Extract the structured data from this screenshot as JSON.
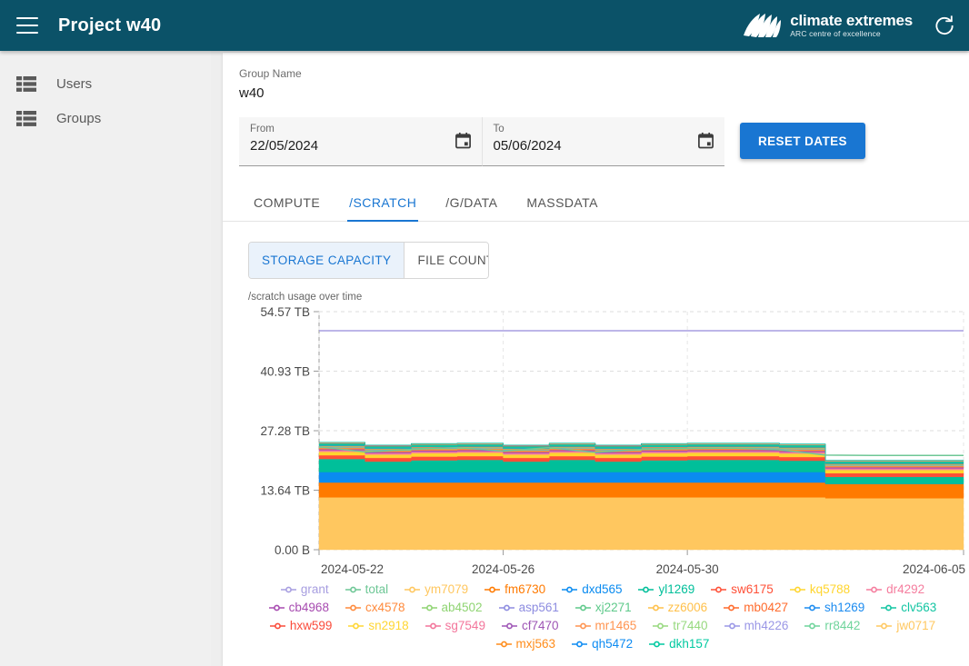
{
  "appbar": {
    "menu_icon": "hamburger-icon",
    "title": "Project w40",
    "logo_main": "climate extremes",
    "logo_sub": "ARC centre of excellence",
    "refresh_icon": "refresh-icon",
    "bg_color": "#0b5268"
  },
  "sidebar": {
    "items": [
      {
        "label": "Users",
        "icon": "list-icon"
      },
      {
        "label": "Groups",
        "icon": "list-icon"
      }
    ]
  },
  "form": {
    "group_name_label": "Group Name",
    "group_name_value": "w40",
    "from_label": "From",
    "from_value": "22/05/2024",
    "to_label": "To",
    "to_value": "05/06/2024",
    "calendar_icon": "calendar-icon",
    "reset_button": "RESET DATES"
  },
  "tabs": {
    "items": [
      "COMPUTE",
      "/SCRATCH",
      "/G/DATA",
      "MASSDATA"
    ],
    "active": "/SCRATCH",
    "accent": "#1976d2"
  },
  "subtabs": {
    "items": [
      "STORAGE CAPACITY",
      "FILE COUNTS"
    ],
    "active": "STORAGE CAPACITY"
  },
  "chart_data": {
    "type": "area",
    "title": "/scratch usage over time",
    "xlabel": "",
    "ylabel": "",
    "grid": true,
    "legend_position": "bottom",
    "ylim": [
      0,
      54.57
    ],
    "y_unit": "TB",
    "yticks": [
      0,
      13.64,
      27.28,
      40.93,
      54.57
    ],
    "ytick_labels": [
      "0.00 B",
      "13.64 TB",
      "27.28 TB",
      "40.93 TB",
      "54.57 TB"
    ],
    "x": [
      "2024-05-22",
      "2024-05-23",
      "2024-05-24",
      "2024-05-25",
      "2024-05-26",
      "2024-05-27",
      "2024-05-28",
      "2024-05-29",
      "2024-05-30",
      "2024-05-31",
      "2024-06-01",
      "2024-06-02",
      "2024-06-03",
      "2024-06-04",
      "2024-06-05"
    ],
    "xtick_labels": [
      "2024-05-22",
      "2024-05-26",
      "2024-05-30",
      "2024-06-05"
    ],
    "xtick_positions": [
      0,
      4,
      8,
      14
    ],
    "lines": [
      {
        "name": "grant",
        "color": "#a79ee0",
        "type": "line",
        "values": [
          50.2,
          50.2,
          50.2,
          50.2,
          50.2,
          50.2,
          50.2,
          50.2,
          50.2,
          50.2,
          50.2,
          50.2,
          50.2,
          50.2,
          50.2
        ]
      },
      {
        "name": "total",
        "color": "#6ec796",
        "type": "line",
        "values": [
          23.6,
          22.4,
          23.0,
          23.4,
          22.6,
          23.4,
          22.3,
          23.0,
          23.2,
          23.3,
          22.9,
          21.7,
          21.6,
          21.6,
          21.6
        ]
      }
    ],
    "series": [
      {
        "name": "ym7079",
        "color": "#ffc75f",
        "values": [
          12.0,
          12.0,
          12.0,
          12.0,
          12.0,
          12.0,
          12.0,
          12.0,
          12.0,
          12.0,
          12.0,
          11.8,
          11.8,
          11.8,
          11.8
        ]
      },
      {
        "name": "fm6730",
        "color": "#ff7a00",
        "values": [
          3.4,
          3.4,
          3.4,
          3.4,
          3.4,
          3.4,
          3.4,
          3.4,
          3.4,
          3.4,
          3.4,
          3.3,
          3.3,
          3.3,
          3.3
        ]
      },
      {
        "name": "dxd565",
        "color": "#0a8bf0",
        "values": [
          2.4,
          2.4,
          2.4,
          2.4,
          2.4,
          2.4,
          2.4,
          2.4,
          2.4,
          2.4,
          2.4,
          0.0,
          0.0,
          0.0,
          0.0
        ]
      },
      {
        "name": "yl1269",
        "color": "#00bf9a",
        "values": [
          3.0,
          2.4,
          2.7,
          2.8,
          2.4,
          2.8,
          2.4,
          2.7,
          2.8,
          2.8,
          2.6,
          1.6,
          1.6,
          1.6,
          1.6
        ]
      },
      {
        "name": "sw6175",
        "color": "#ff4f36",
        "values": [
          0.85,
          0.85,
          0.85,
          0.85,
          0.85,
          0.85,
          0.85,
          0.85,
          0.85,
          0.85,
          0.85,
          0.85,
          0.85,
          0.85,
          0.85
        ]
      },
      {
        "name": "kq5788",
        "color": "#ffd52e",
        "values": [
          0.8,
          0.75,
          0.8,
          0.8,
          0.75,
          0.8,
          0.75,
          0.8,
          0.8,
          0.8,
          0.8,
          0.75,
          0.75,
          0.75,
          0.75
        ]
      },
      {
        "name": "dr4292",
        "color": "#f57d9e",
        "values": [
          0.35,
          0.35,
          0.35,
          0.35,
          0.35,
          0.35,
          0.35,
          0.35,
          0.35,
          0.35,
          0.35,
          0.35,
          0.35,
          0.35,
          0.35
        ]
      },
      {
        "name": "cb4968",
        "color": "#a74bb0",
        "values": [
          0.25,
          0.25,
          0.25,
          0.25,
          0.25,
          0.25,
          0.25,
          0.25,
          0.25,
          0.25,
          0.25,
          0.25,
          0.25,
          0.25,
          0.25
        ]
      },
      {
        "name": "cx4578",
        "color": "#ff8a3c",
        "values": [
          0.3,
          0.3,
          0.3,
          0.3,
          0.3,
          0.3,
          0.3,
          0.3,
          0.3,
          0.3,
          0.3,
          0.3,
          0.3,
          0.3,
          0.3
        ]
      },
      {
        "name": "ab4502",
        "color": "#8fd472",
        "values": [
          0.12,
          0.12,
          0.12,
          0.12,
          0.12,
          0.12,
          0.12,
          0.12,
          0.12,
          0.12,
          0.12,
          0.12,
          0.12,
          0.12,
          0.12
        ]
      },
      {
        "name": "asp561",
        "color": "#8d8ce0",
        "values": [
          0.1,
          0.1,
          0.1,
          0.1,
          0.1,
          0.1,
          0.1,
          0.1,
          0.1,
          0.1,
          0.1,
          0.1,
          0.1,
          0.1,
          0.1
        ]
      },
      {
        "name": "xj2271",
        "color": "#5ec98a",
        "values": [
          0.1,
          0.1,
          0.1,
          0.1,
          0.1,
          0.1,
          0.1,
          0.1,
          0.1,
          0.1,
          0.1,
          0.1,
          0.1,
          0.1,
          0.1
        ]
      },
      {
        "name": "zz6006",
        "color": "#ffc04a",
        "values": [
          0.08,
          0.08,
          0.08,
          0.08,
          0.08,
          0.08,
          0.08,
          0.08,
          0.08,
          0.08,
          0.08,
          0.08,
          0.08,
          0.08,
          0.08
        ]
      },
      {
        "name": "mb0427",
        "color": "#ff6a2b",
        "values": [
          0.08,
          0.08,
          0.08,
          0.08,
          0.08,
          0.08,
          0.08,
          0.08,
          0.08,
          0.08,
          0.08,
          0.08,
          0.08,
          0.08,
          0.08
        ]
      },
      {
        "name": "sh1269",
        "color": "#1b8bf0",
        "values": [
          0.06,
          0.06,
          0.06,
          0.06,
          0.06,
          0.06,
          0.06,
          0.06,
          0.06,
          0.06,
          0.06,
          0.06,
          0.06,
          0.06,
          0.06
        ]
      },
      {
        "name": "clv563",
        "color": "#12c5a2",
        "values": [
          0.5,
          0.5,
          0.5,
          0.5,
          0.5,
          0.5,
          0.5,
          0.5,
          0.5,
          0.5,
          0.5,
          0.5,
          0.5,
          0.5,
          0.5
        ]
      },
      {
        "name": "hxw599",
        "color": "#fa4b3a",
        "values": [
          0.04,
          0.04,
          0.04,
          0.04,
          0.04,
          0.04,
          0.04,
          0.04,
          0.04,
          0.04,
          0.04,
          0.04,
          0.04,
          0.04,
          0.04
        ]
      },
      {
        "name": "sn2918",
        "color": "#ffd633",
        "values": [
          0.04,
          0.04,
          0.04,
          0.04,
          0.04,
          0.04,
          0.04,
          0.04,
          0.04,
          0.04,
          0.04,
          0.04,
          0.04,
          0.04,
          0.04
        ]
      },
      {
        "name": "sg7549",
        "color": "#f3759b",
        "values": [
          0.03,
          0.03,
          0.03,
          0.03,
          0.03,
          0.03,
          0.03,
          0.03,
          0.03,
          0.03,
          0.03,
          0.03,
          0.03,
          0.03,
          0.03
        ]
      },
      {
        "name": "cf7470",
        "color": "#9e55b5",
        "values": [
          0.03,
          0.03,
          0.03,
          0.03,
          0.03,
          0.03,
          0.03,
          0.03,
          0.03,
          0.03,
          0.03,
          0.03,
          0.03,
          0.03,
          0.03
        ]
      },
      {
        "name": "mr1465",
        "color": "#ff9450",
        "values": [
          0.02,
          0.02,
          0.02,
          0.02,
          0.02,
          0.02,
          0.02,
          0.02,
          0.02,
          0.02,
          0.02,
          0.02,
          0.02,
          0.02,
          0.02
        ]
      },
      {
        "name": "tr7440",
        "color": "#97d97f",
        "values": [
          0.02,
          0.02,
          0.02,
          0.02,
          0.02,
          0.02,
          0.02,
          0.02,
          0.02,
          0.02,
          0.02,
          0.02,
          0.02,
          0.02,
          0.02
        ]
      },
      {
        "name": "mh4226",
        "color": "#9a97e6",
        "values": [
          0.02,
          0.02,
          0.02,
          0.02,
          0.02,
          0.02,
          0.02,
          0.02,
          0.02,
          0.02,
          0.02,
          0.02,
          0.02,
          0.02,
          0.02
        ]
      },
      {
        "name": "rr8442",
        "color": "#6fd49b",
        "values": [
          0.01,
          0.01,
          0.01,
          0.01,
          0.01,
          0.01,
          0.01,
          0.01,
          0.01,
          0.01,
          0.01,
          0.01,
          0.01,
          0.01,
          0.01
        ]
      },
      {
        "name": "jw0717",
        "color": "#ffc861",
        "values": [
          0.01,
          0.01,
          0.01,
          0.01,
          0.01,
          0.01,
          0.01,
          0.01,
          0.01,
          0.01,
          0.01,
          0.01,
          0.01,
          0.01,
          0.01
        ]
      },
      {
        "name": "mxj563",
        "color": "#ff8c1a",
        "values": [
          0.01,
          0.01,
          0.01,
          0.01,
          0.01,
          0.01,
          0.01,
          0.01,
          0.01,
          0.01,
          0.01,
          0.01,
          0.01,
          0.01,
          0.01
        ]
      },
      {
        "name": "qh5472",
        "color": "#0d8bf2",
        "values": [
          0.01,
          0.01,
          0.01,
          0.01,
          0.01,
          0.01,
          0.01,
          0.01,
          0.01,
          0.01,
          0.01,
          0.01,
          0.01,
          0.01,
          0.01
        ]
      },
      {
        "name": "dkh157",
        "color": "#00c9a0",
        "values": [
          0.01,
          0.01,
          0.01,
          0.01,
          0.01,
          0.01,
          0.01,
          0.01,
          0.01,
          0.01,
          0.01,
          0.01,
          0.01,
          0.01,
          0.01
        ]
      }
    ],
    "legend_rows": [
      [
        "grant",
        "total",
        "ym7079",
        "fm6730",
        "dxd565",
        "yl1269",
        "sw6175",
        "kq5788",
        "dr4292"
      ],
      [
        "cb4968",
        "cx4578",
        "ab4502",
        "asp561",
        "xj2271",
        "zz6006",
        "mb0427",
        "sh1269",
        "clv563"
      ],
      [
        "hxw599",
        "sn2918",
        "sg7549",
        "cf7470",
        "mr1465",
        "tr7440",
        "mh4226",
        "rr8442",
        "jw0717"
      ],
      [
        "mxj563",
        "qh5472",
        "dkh157"
      ]
    ]
  }
}
